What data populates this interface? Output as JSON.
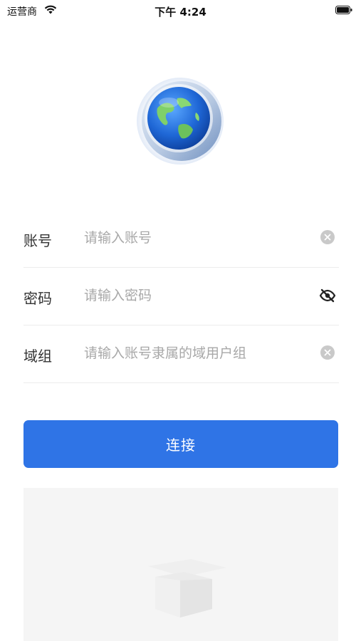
{
  "status_bar": {
    "carrier": "运营商",
    "time": "下午 4:24",
    "wifi_icon": "wifi-icon",
    "battery_icon": "battery-icon"
  },
  "logo": {
    "icon": "globe-logo-icon"
  },
  "form": {
    "account": {
      "label": "账号",
      "value": "",
      "placeholder": "请输入账号",
      "action_icon": "clear-icon"
    },
    "password": {
      "label": "密码",
      "value": "",
      "placeholder": "请输入密码",
      "action_icon": "eye-hidden-icon"
    },
    "domain_group": {
      "label": "域组",
      "value": "",
      "placeholder": "请输入账号隶属的域用户组",
      "action_icon": "clear-icon"
    }
  },
  "connect_button": {
    "label": "连接"
  },
  "empty_panel": {
    "illustration_icon": "empty-box-icon"
  },
  "colors": {
    "primary": "#2f74e6",
    "placeholder": "#a8a8a8",
    "divider": "#ececec",
    "panel_bg": "#f5f5f5"
  }
}
